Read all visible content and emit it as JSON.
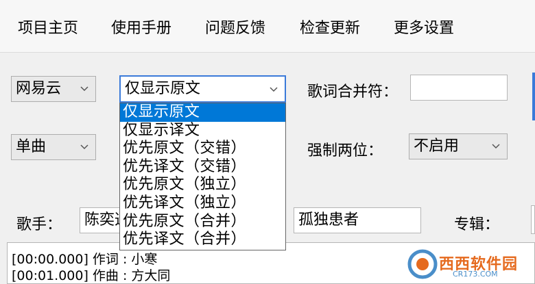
{
  "menu": [
    "项目主页",
    "使用手册",
    "问题反馈",
    "检查更新",
    "更多设置"
  ],
  "source_select": {
    "value": "网易云"
  },
  "display_select": {
    "value": "仅显示原文",
    "options": [
      "仅显示原文",
      "仅显示译文",
      "优先原文（交错）",
      "优先译文（交错）",
      "优先原文（独立）",
      "优先译文（独立）",
      "优先原文（合并）",
      "优先译文（合并）"
    ],
    "selected_index": 0
  },
  "merge_char": {
    "label": "歌词合并符：",
    "value": ""
  },
  "type_select": {
    "value": "单曲"
  },
  "force_two_digit": {
    "label": "强制两位：",
    "value": "不启用"
  },
  "singer": {
    "label": "歌手：",
    "value": "陈奕迅"
  },
  "song_title": {
    "value": "孤独患者"
  },
  "album": {
    "label": "专辑："
  },
  "log_lines": [
    "[00:00.000] 作词 : 小寒",
    "[00:01.000] 作曲 : 方大同"
  ],
  "watermark": {
    "text": "西西软件园",
    "sub": "CR173.COM"
  },
  "colors": {
    "accent": "#0078d7",
    "watermark": "#e56a1e"
  }
}
